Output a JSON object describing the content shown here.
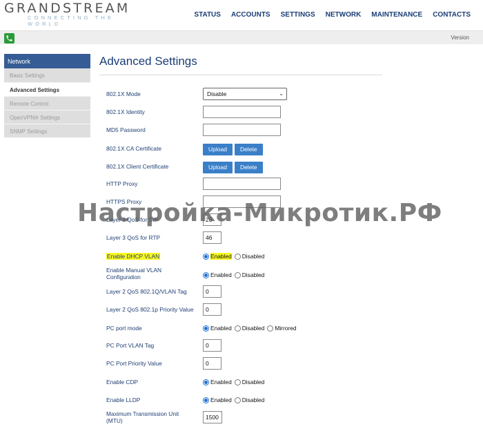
{
  "brand": {
    "name": "GRANDSTREAM",
    "tagline": "CONNECTING THE WORLD"
  },
  "nav": [
    "STATUS",
    "ACCOUNTS",
    "SETTINGS",
    "NETWORK",
    "MAINTENANCE",
    "CONTACTS"
  ],
  "subbar": {
    "version": "Version"
  },
  "sidebar": {
    "header": "Network",
    "items": [
      "Basic Settings",
      "Advanced Settings",
      "Remote Control",
      "OpenVPN® Settings",
      "SNMP Settings"
    ]
  },
  "page": {
    "title": "Advanced Settings"
  },
  "form": {
    "dot1x_mode": {
      "label": "802.1X Mode",
      "value": "Disable"
    },
    "dot1x_identity": {
      "label": "802.1X Identity",
      "value": ""
    },
    "md5_password": {
      "label": "MD5 Password",
      "value": ""
    },
    "ca_cert": {
      "label": "802.1X CA Certificate",
      "upload": "Upload",
      "delete": "Delete"
    },
    "client_cert": {
      "label": "802.1X Client Certificate",
      "upload": "Upload",
      "delete": "Delete"
    },
    "http_proxy": {
      "label": "HTTP Proxy",
      "value": ""
    },
    "https_proxy": {
      "label": "HTTPS Proxy",
      "value": ""
    },
    "qos_sip": {
      "label": "Layer 3 QoS for SIP",
      "value": "26"
    },
    "qos_rtp": {
      "label": "Layer 3 QoS for RTP",
      "value": "46"
    },
    "dhcp_vlan": {
      "label": "Enable DHCP VLAN",
      "options": [
        "Enabled",
        "Disabled"
      ],
      "selected": "Enabled"
    },
    "manual_vlan": {
      "label_line1": "Enable Manual VLAN",
      "label_line2": "Configuration",
      "options": [
        "Enabled",
        "Disabled"
      ],
      "selected": "Enabled"
    },
    "vlan_tag": {
      "label": "Layer 2 QoS 802.1Q/VLAN Tag",
      "value": "0"
    },
    "priority_value": {
      "label": "Layer 2 QoS 802.1p Priority Value",
      "value": "0"
    },
    "pc_port_mode": {
      "label": "PC port mode",
      "options": [
        "Enabled",
        "Disabled",
        "Mirrored"
      ],
      "selected": "Enabled"
    },
    "pc_vlan_tag": {
      "label": "PC Port VLAN Tag",
      "value": "0"
    },
    "pc_priority": {
      "label": "PC Port Priority Value",
      "value": "0"
    },
    "cdp": {
      "label": "Enable CDP",
      "options": [
        "Enabled",
        "Disabled"
      ],
      "selected": "Enabled"
    },
    "lldp": {
      "label": "Enable LLDP",
      "options": [
        "Enabled",
        "Disabled"
      ],
      "selected": "Enabled"
    },
    "mtu": {
      "label_line1": "Maximum Transmission Unit",
      "label_line2": "(MTU)",
      "value": "1500"
    }
  },
  "watermark": "Настройка-Микротик.РФ",
  "colors": {
    "nav": "#1a3d75",
    "sidebar_header": "#355c94",
    "button": "#3a7fc8",
    "highlight": "#f8f820",
    "phone_icon": "#2a9a3a"
  }
}
